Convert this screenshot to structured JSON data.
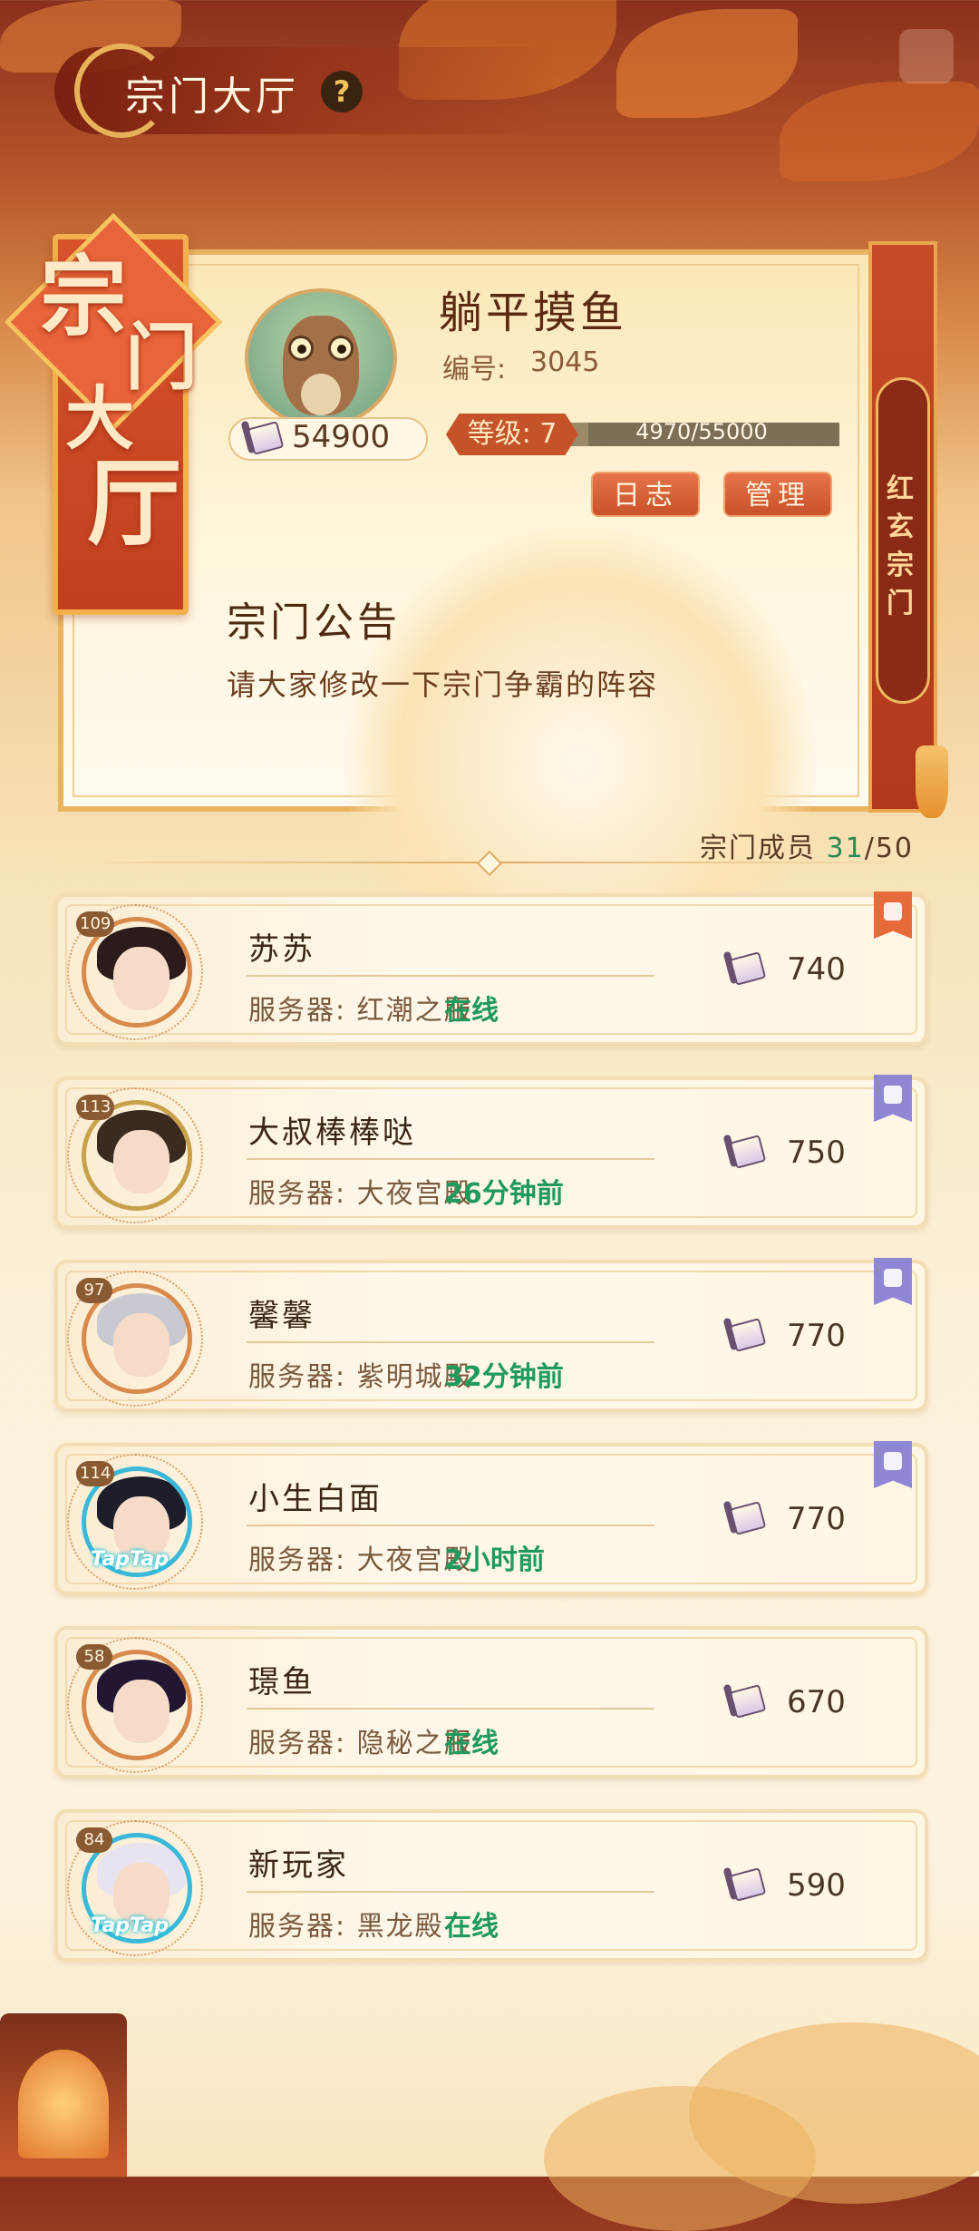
{
  "header": {
    "title": "宗门大厅",
    "help_symbol": "?"
  },
  "banner": {
    "chars": [
      "宗",
      "门",
      "大",
      "厅"
    ]
  },
  "guild": {
    "name_chars": [
      "红",
      "玄",
      "宗",
      "门"
    ],
    "player_name": "躺平摸鱼",
    "id_label": "编号:",
    "id_value": "3045",
    "currency_value": "54900",
    "level_label": "等级: 7",
    "xp_text": "4970/55000",
    "xp_fraction": 0.09,
    "buttons": {
      "log": "日志",
      "manage": "管理"
    },
    "notice_title": "宗门公告",
    "notice_text": "请大家修改一下宗门争霸的阵容"
  },
  "members_header": {
    "label": "宗门成员",
    "count_online": "31",
    "count_total": "/50"
  },
  "members": [
    {
      "level": "109",
      "name": "苏苏",
      "server": "服务器: 红潮之",
      "server_tail": "服",
      "status": "在线",
      "contribution": "740",
      "badge": "orange",
      "taptap": ""
    },
    {
      "level": "113",
      "name": "大叔棒棒哒",
      "server": "服务器: 大夜宫",
      "server_tail": "殿",
      "status": "26分钟前",
      "contribution": "750",
      "badge": "purple",
      "taptap": ""
    },
    {
      "level": "97",
      "name": "馨馨",
      "server": "服务器: 紫明城",
      "server_tail": "殿",
      "status": "32分钟前",
      "contribution": "770",
      "badge": "purple",
      "taptap": ""
    },
    {
      "level": "114",
      "name": "小生白面",
      "server": "服务器: 大夜宫",
      "server_tail": "殿",
      "status": "2小时前",
      "contribution": "770",
      "badge": "purple",
      "taptap": "TapTap"
    },
    {
      "level": "58",
      "name": "璟鱼",
      "server": "服务器: 隐秘之",
      "server_tail": "服",
      "status": "在线",
      "contribution": "670",
      "badge": "",
      "taptap": ""
    },
    {
      "level": "84",
      "name": "新玩家",
      "server": "服务器: 黑龙殿",
      "server_tail": "",
      "status": "在线",
      "contribution": "590",
      "badge": "",
      "taptap": "TapTap"
    }
  ],
  "colors": {
    "online": "#1f9a5c",
    "badge_orange": "#e66a3a",
    "badge_purple": "#8f87d6"
  }
}
